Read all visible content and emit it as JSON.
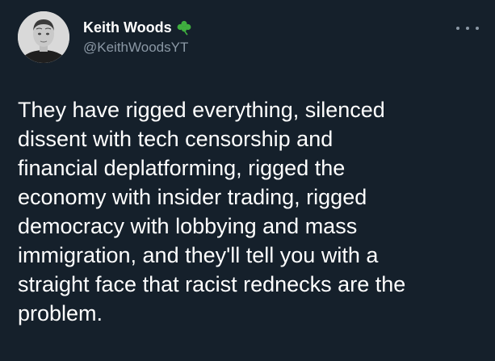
{
  "tweet": {
    "author": {
      "display_name": "Keith Woods",
      "handle": "@KeithWoodsYT",
      "badge_icon": "shamrock-icon",
      "avatar_icon": "avatar-photo"
    },
    "more_icon": "more-options-icon",
    "text": "They have rigged everything, silenced\ndissent with tech censorship and\nfinancial deplatforming, rigged the\neconomy with insider trading, rigged\ndemocracy with lobbying and mass\nimmigration, and they'll tell you with a\nstraight face that racist rednecks are the\nproblem."
  },
  "colors": {
    "background": "#15202b",
    "text": "#ffffff",
    "secondary_text": "#8b98a5",
    "shamrock": "#3fae3f"
  }
}
